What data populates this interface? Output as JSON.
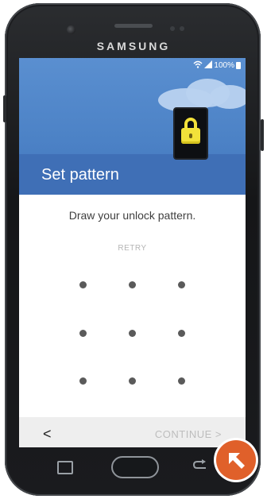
{
  "device": {
    "brand": "SAMSUNG"
  },
  "status_bar": {
    "battery_percent": "100%"
  },
  "header": {
    "title": "Set pattern"
  },
  "content": {
    "instruction": "Draw your unlock pattern.",
    "retry_label": "RETRY"
  },
  "pattern_grid": {
    "rows": 3,
    "cols": 3
  },
  "bottom_bar": {
    "back_label": "<",
    "continue_label": "CONTINUE >"
  },
  "colors": {
    "header_blue": "#4c82c6",
    "accent_orange": "#e0602a",
    "lock_yellow": "#f2e13a"
  },
  "icons": [
    "wifi-icon",
    "signal-icon",
    "battery-icon",
    "lock-icon",
    "recents-icon",
    "home-button",
    "back-icon",
    "arrow-up-left-icon"
  ]
}
